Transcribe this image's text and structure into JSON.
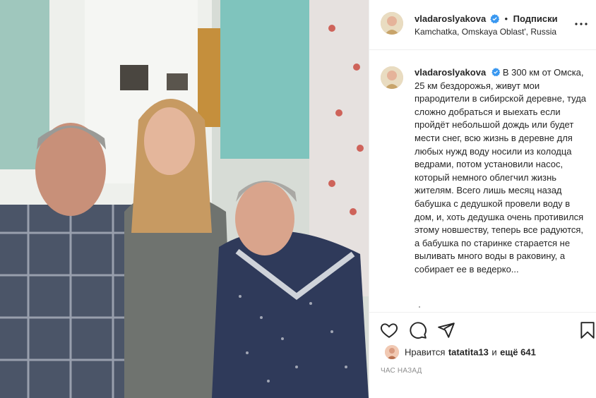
{
  "post": {
    "username": "vladaroslyakova",
    "follow_label": "Подписки",
    "separator": "•",
    "location": "Kamchatka, Omskaya Oblast', Russia",
    "caption": "В 300 км от Омска, 25 км бездорожья, живут мои прародители в сибирской деревне, туда сложно добраться и выехать если пройдёт небольшой дождь или будет мести снег, всю жизнь в деревне для любых нужд воду носили из колодца ведрами, потом установили насос, который немного облегчил жизнь жителям. Всего лишь месяц назад бабушка с дедушкой провели воду в дом, и, хоть дедушка очень противился этому новшеству, теперь все радуются, а бабушка по старинке старается не выливать много воды в раковину, а собирает ее в ведерко...",
    "likes": {
      "prefix": "Нравится",
      "liker": "tatatita13",
      "conjunction": "и",
      "others": "ещё 641"
    },
    "timestamp": "час назад"
  },
  "icons": {
    "verified": "verified-badge-icon",
    "more": "more-options-icon",
    "like": "heart-icon",
    "comment": "comment-bubble-icon",
    "share": "paper-plane-icon",
    "save": "bookmark-icon"
  },
  "colors": {
    "verified": "#3897f0",
    "text": "#262626",
    "muted": "#8e8e8e",
    "divider": "#efefef"
  }
}
